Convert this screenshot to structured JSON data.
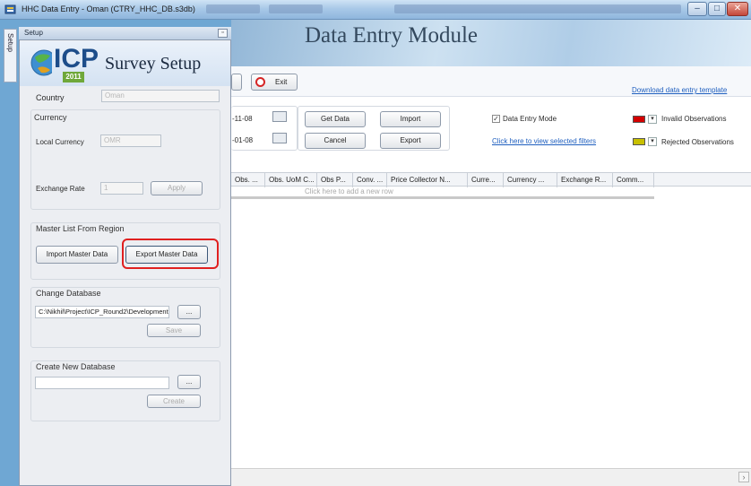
{
  "window": {
    "title": "HHC Data Entry - Oman (CTRY_HHC_DB.s3db)",
    "minimize": "–",
    "maximize": "□",
    "close": "✕"
  },
  "side_tab": "Setup",
  "setup_panel": {
    "header": "Setup",
    "pin_icon": "▫",
    "logo_text": "ICP",
    "logo_year": "2011",
    "title": "Survey Setup",
    "country_label": "Country",
    "country_value": "Oman",
    "currency_section": "Currency",
    "local_currency_label": "Local Currency",
    "local_currency_value": "OMR",
    "exchange_rate_label": "Exchange Rate",
    "exchange_rate_value": "1",
    "apply_label": "Apply",
    "master_section": "Master List From Region",
    "import_master_label": "Import Master Data",
    "export_master_label": "Export Master Data",
    "change_db_section": "Change Database",
    "db_path": "C:\\Nikhil\\Project\\ICP_Round2\\Development",
    "browse_label": "...",
    "save_label": "Save",
    "create_db_section": "Create New Database",
    "create_browse_label": "...",
    "create_label": "Create"
  },
  "main": {
    "module_title": "Data Entry Module",
    "exit_label": "Exit",
    "download_link": "Download data entry template",
    "date_from": "-11-08",
    "date_to": "-01-08",
    "get_data_label": "Get Data",
    "import_label": "Import",
    "cancel_label": "Cancel",
    "export_label": "Export",
    "data_entry_mode_label": "Data Entry Mode",
    "checkbox_mark": "✓",
    "filters_link": "Click here to view selected filters",
    "invalid_label": "Invalid Observations",
    "rejected_label": "Rejected Observations",
    "dd_arrow": "▾",
    "invalid_color": "#d40000",
    "rejected_color": "#c8c000",
    "grid_columns": [
      "Obs. ...",
      "Obs. UoM C...",
      "Obs P...",
      "Conv. ...",
      "Price Collector N...",
      "Curre...",
      "Currency ...",
      "Exchange R...",
      "Comm..."
    ],
    "add_row_hint": "Click here to add a new row",
    "scroll_arrow": "›"
  }
}
